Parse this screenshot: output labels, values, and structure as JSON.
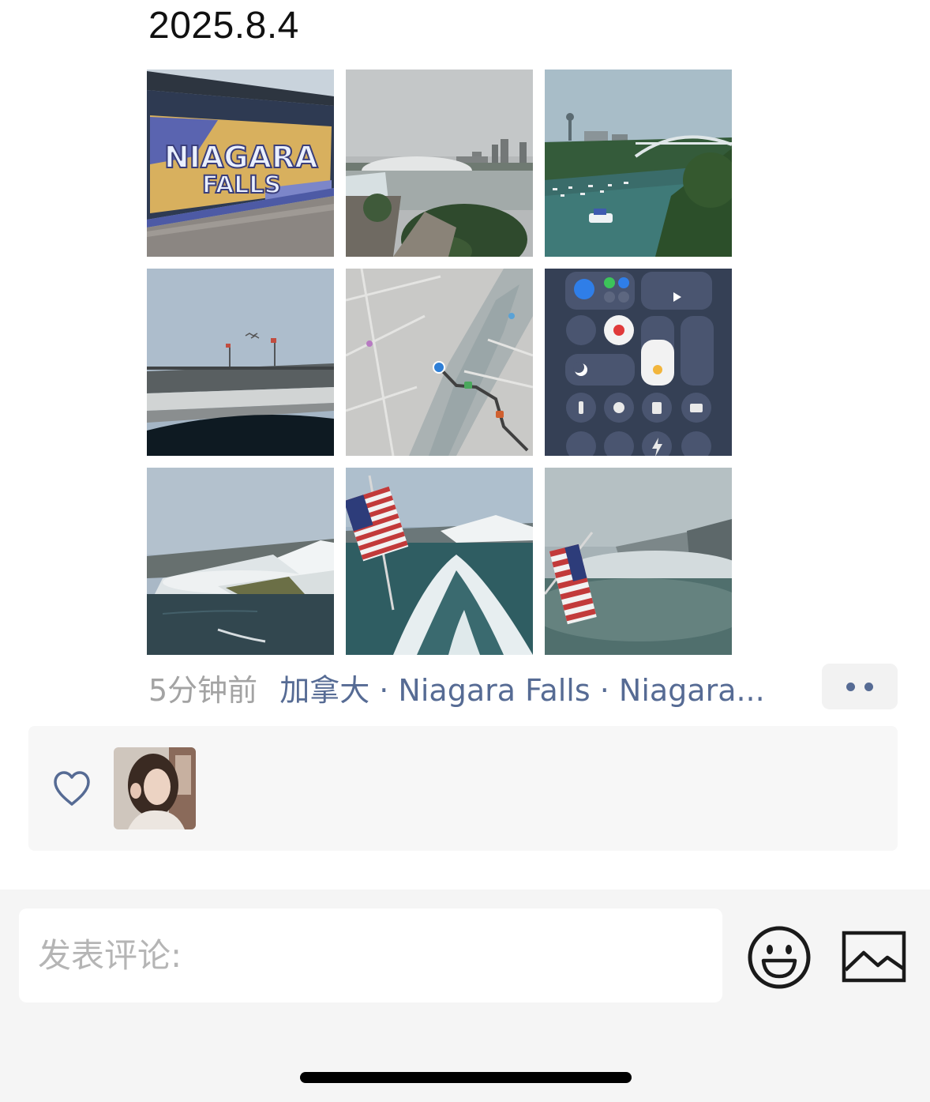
{
  "post": {
    "text": "2025.8.4",
    "photos": [
      {
        "icon": "niagara-falls-mural-photo"
      },
      {
        "icon": "horseshoe-falls-skyline-photo"
      },
      {
        "icon": "rainbow-bridge-river-photo"
      },
      {
        "icon": "bridge-flags-photo"
      },
      {
        "icon": "map-route-screenshot"
      },
      {
        "icon": "control-center-screenshot"
      },
      {
        "icon": "american-falls-photo"
      },
      {
        "icon": "boat-flag-wake-photo"
      },
      {
        "icon": "boat-flag-falls-mist-photo"
      }
    ],
    "time": "5分钟前",
    "location": "加拿大 · Niagara Falls · Niagara...",
    "more_icon": "more-dots-icon"
  },
  "likes": {
    "icon": "heart-outline-icon",
    "avatars": [
      {
        "icon": "liker-avatar"
      }
    ]
  },
  "comment": {
    "placeholder": "发表评论:",
    "value": "",
    "emoji_icon": "smiley-face-icon",
    "image_icon": "image-icon"
  },
  "colors": {
    "link": "#566b94",
    "muted": "#a3a3a3",
    "panel_bg": "#f7f7f7",
    "bar_bg": "#f5f5f5"
  }
}
